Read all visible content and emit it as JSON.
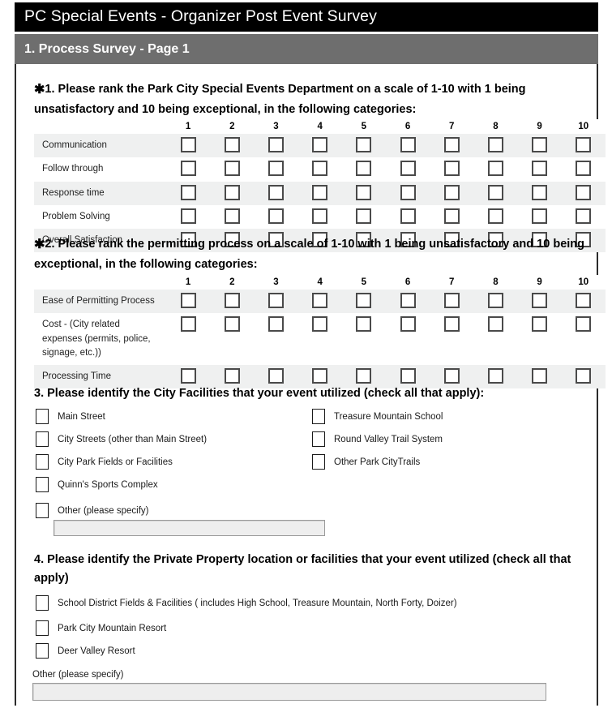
{
  "header": {
    "title": "PC Special Events - Organizer Post Event Survey",
    "section": "1. Process Survey - Page 1"
  },
  "colors": {
    "title_bar": "#000000",
    "section_bar": "#6e6e6e",
    "row_shade": "#eff0f0",
    "input_fill": "#eeeeee",
    "frame_border": "#2b2b2b"
  },
  "questions": {
    "q1": {
      "required_marker": "✱",
      "text": "1. Please rank the Park City Special Events Department on a scale of 1-10 with 1 being unsatisfactory and 10 being exceptional, in the following categories:",
      "scale": [
        "1",
        "2",
        "3",
        "4",
        "5",
        "6",
        "7",
        "8",
        "9",
        "10"
      ],
      "rows": [
        "Communication",
        "Follow through",
        "Response time",
        "Problem Solving",
        "Overall Satisfaction"
      ]
    },
    "q2": {
      "required_marker": "✱",
      "text": "2. Please rank the permitting process on a scale of 1-10 with 1 being unsatisfactory and 10 being exceptional, in the following categories:",
      "scale": [
        "1",
        "2",
        "3",
        "4",
        "5",
        "6",
        "7",
        "8",
        "9",
        "10"
      ],
      "rows": [
        "Ease of Permitting Process",
        "Cost - (City related expenses (permits, police, signage, etc.))",
        "Processing Time"
      ]
    },
    "q3": {
      "text": "3. Please identify the City Facilities that your event utilized (check all that apply):",
      "options_left": [
        "Main Street",
        "City Streets (other than Main Street)",
        "City Park Fields or Facilities",
        "Quinn's Sports Complex",
        "Other (please specify)"
      ],
      "options_right": [
        "Treasure Mountain School",
        "Round Valley Trail System",
        "Other Park CityTrails"
      ],
      "other_value": ""
    },
    "q4": {
      "text": "4. Please identify the Private Property location or facilities that your event utilized (check all that apply)",
      "options": [
        "School District Fields & Facilities ( includes High School, Treasure Mountain, North Forty, Doizer)",
        "Park City Mountain Resort",
        "Deer Valley Resort"
      ],
      "other_label": "Other (please specify)",
      "other_value": ""
    }
  }
}
